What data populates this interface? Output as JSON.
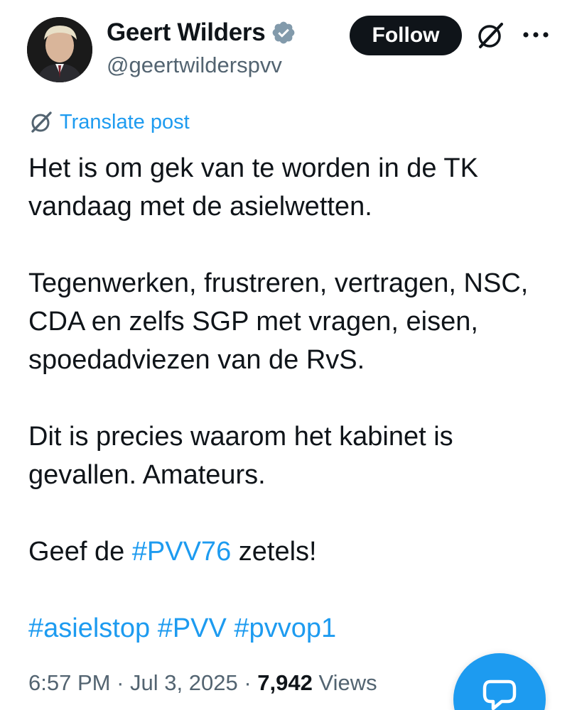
{
  "author": {
    "display_name": "Geert Wilders",
    "handle": "@geertwilderspvv",
    "verified": true,
    "avatar_icon": "profile-photo"
  },
  "actions": {
    "follow_label": "Follow",
    "grok_icon": "grok-icon",
    "more_icon": "more-icon"
  },
  "translate": {
    "label": "Translate post",
    "icon": "translate-icon"
  },
  "post": {
    "paragraphs": {
      "p1": "Het is om gek van te worden in de TK vandaag met de asielwetten.",
      "p2": "Tegenwerken, frustreren, vertragen, NSC, CDA en zelfs SGP met vragen, eisen, spoedadviezen van de RvS.",
      "p3": "Dit is precies waarom het kabinet is gevallen. Amateurs.",
      "p4_before": "Geef de ",
      "p4_hashtag": "#PVV76",
      "p4_after": " zetels!"
    },
    "hashtags": {
      "h1": "#asielstop",
      "h2": "#PVV",
      "h3": "#pvvop1"
    }
  },
  "meta": {
    "time": "6:57 PM",
    "separator": "·",
    "date": "Jul 3, 2025",
    "views_count": "7,942",
    "views_label": "Views"
  },
  "colors": {
    "accent": "#1d9bf0",
    "text": "#0f1419",
    "muted": "#536471",
    "follow_bg": "#0f1419"
  },
  "fab": {
    "icon": "reply-compose-icon"
  }
}
